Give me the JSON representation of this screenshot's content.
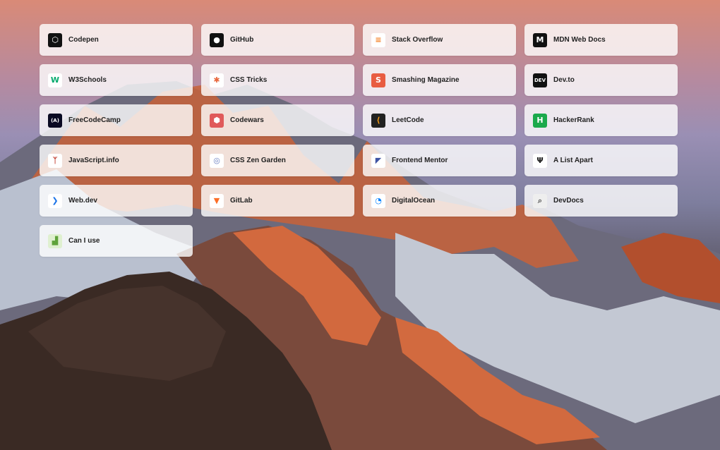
{
  "links": [
    {
      "label": "Codepen",
      "icon": "codepen-icon",
      "glyph": "⬡",
      "fg": "#ffffff",
      "bg": "#111111"
    },
    {
      "label": "GitHub",
      "icon": "github-icon",
      "glyph": "●",
      "fg": "#ffffff",
      "bg": "#111111"
    },
    {
      "label": "Stack Overflow",
      "icon": "stackoverflow-icon",
      "glyph": "≡",
      "fg": "#f48024",
      "bg": "#ffffff"
    },
    {
      "label": "MDN Web Docs",
      "icon": "mdn-icon",
      "glyph": "M",
      "fg": "#ffffff",
      "bg": "#111111"
    },
    {
      "label": "W3Schools",
      "icon": "w3schools-icon",
      "glyph": "W",
      "fg": "#04aa6d",
      "bg": "#ffffff"
    },
    {
      "label": "CSS Tricks",
      "icon": "csstricks-icon",
      "glyph": "✱",
      "fg": "#e8663c",
      "bg": "#ffffff"
    },
    {
      "label": "Smashing Magazine",
      "icon": "smashing-icon",
      "glyph": "S",
      "fg": "#ffffff",
      "bg": "#e85c41"
    },
    {
      "label": "Dev.to",
      "icon": "devto-icon",
      "glyph": "DEV",
      "fg": "#ffffff",
      "bg": "#111111"
    },
    {
      "label": "FreeCodeCamp",
      "icon": "freecodecamp-icon",
      "glyph": "(A)",
      "fg": "#ffffff",
      "bg": "#0a0a23"
    },
    {
      "label": "Codewars",
      "icon": "codewars-icon",
      "glyph": "⬢",
      "fg": "#ffffff",
      "bg": "#e05a5a"
    },
    {
      "label": "LeetCode",
      "icon": "leetcode-icon",
      "glyph": "⟨",
      "fg": "#ffa116",
      "bg": "#222222"
    },
    {
      "label": "HackerRank",
      "icon": "hackerrank-icon",
      "glyph": "H",
      "fg": "#ffffff",
      "bg": "#1ba94c"
    },
    {
      "label": "JavaScript.info",
      "icon": "javascriptinfo-icon",
      "glyph": "ᛉ",
      "fg": "#c0392b",
      "bg": "#ffffff"
    },
    {
      "label": "CSS Zen Garden",
      "icon": "csszengarden-icon",
      "glyph": "◎",
      "fg": "#6a7fc1",
      "bg": "#ffffff"
    },
    {
      "label": "Frontend Mentor",
      "icon": "frontendmentor-icon",
      "glyph": "◤",
      "fg": "#3e54a3",
      "bg": "#ffffff"
    },
    {
      "label": "A List Apart",
      "icon": "alistapart-icon",
      "glyph": "Ψ",
      "fg": "#222222",
      "bg": "#ffffff"
    },
    {
      "label": "Web.dev",
      "icon": "webdev-icon",
      "glyph": "❯",
      "fg": "#1a73e8",
      "bg": "#ffffff"
    },
    {
      "label": "GitLab",
      "icon": "gitlab-icon",
      "glyph": "▼",
      "fg": "#fc6d26",
      "bg": "#ffffff"
    },
    {
      "label": "DigitalOcean",
      "icon": "digitalocean-icon",
      "glyph": "◔",
      "fg": "#0080ff",
      "bg": "#ffffff"
    },
    {
      "label": "DevDocs",
      "icon": "devdocs-icon",
      "glyph": "⌕",
      "fg": "#555555",
      "bg": "#eeeeee"
    },
    {
      "label": "Can I use",
      "icon": "caniuse-icon",
      "glyph": "▟",
      "fg": "#5fa33b",
      "bg": "#dff0d0"
    }
  ]
}
